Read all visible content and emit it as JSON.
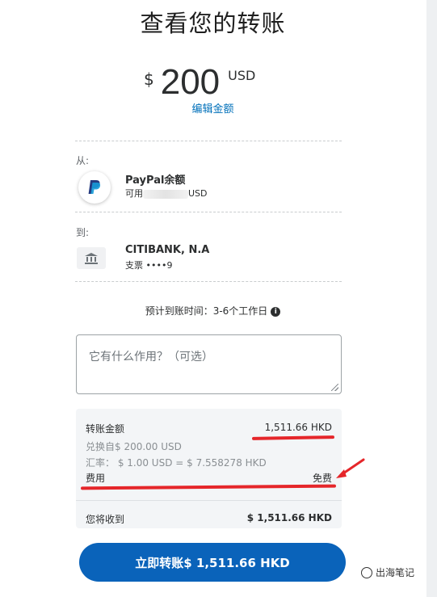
{
  "header": {
    "title": "查看您的转账"
  },
  "amount": {
    "currency_symbol": "$",
    "value": "200",
    "code": "USD",
    "edit_label": "编辑金额"
  },
  "from": {
    "label": "从:",
    "name": "PayPal余额",
    "available_prefix": "可用",
    "available_suffix": "USD"
  },
  "to": {
    "label": "到:",
    "bank_name": "CITIBANK, N.A",
    "account": "支票 ••••9"
  },
  "eta": {
    "text": "预计到账时间：3-6个工作日",
    "info_icon": "info-icon"
  },
  "note": {
    "placeholder": "它有什么作用？（可选）"
  },
  "summary": {
    "transfer_label": "转账金额",
    "transfer_value": "1,511.66 HKD",
    "converted_text": "兑换自$ 200.00 USD",
    "rate_text": "汇率： $ 1.00 USD = $ 7.558278 HKD",
    "fee_label": "费用",
    "fee_value": "免费",
    "receive_label": "您将收到",
    "receive_value": "$ 1,511.66 HKD"
  },
  "cta": {
    "label": "立即转账$ 1,511.66 HKD"
  },
  "watermark": {
    "text": "出海笔记"
  },
  "colors": {
    "accent": "#0070ba",
    "button": "#0a63ba",
    "annotation": "#e5262a"
  }
}
